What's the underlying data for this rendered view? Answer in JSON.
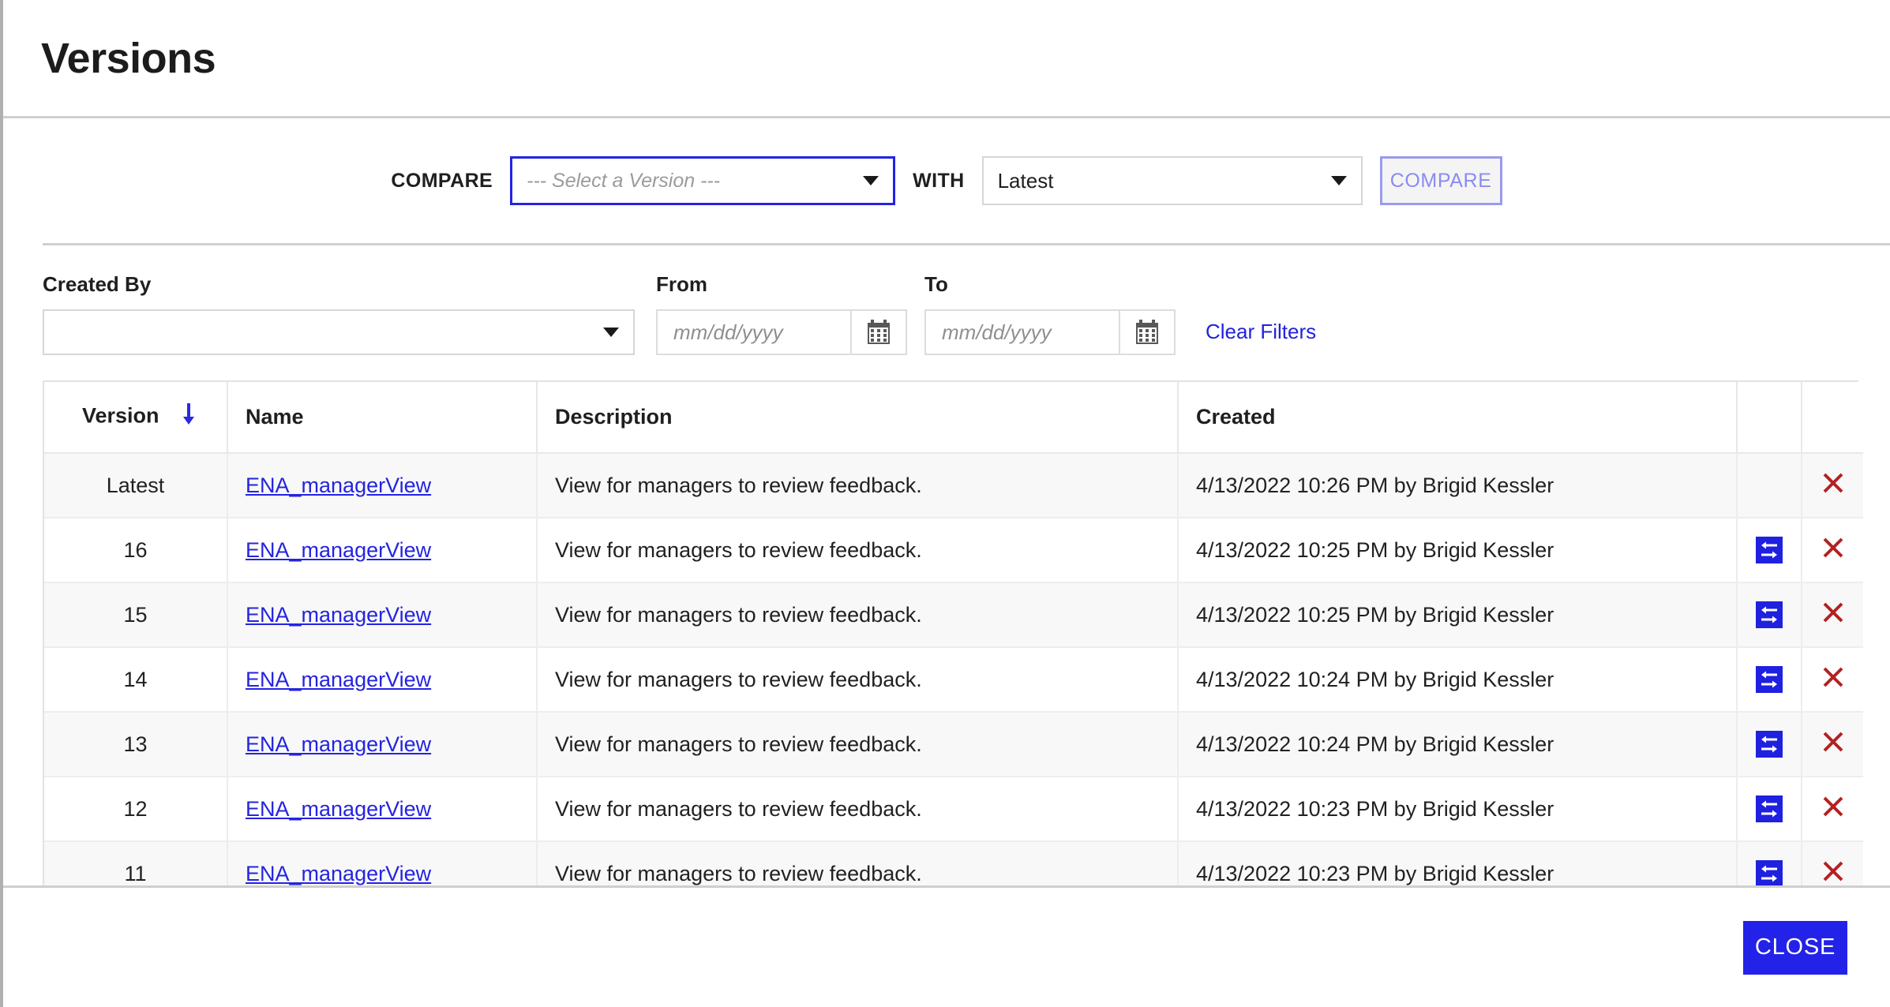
{
  "dialog": {
    "title": "Versions"
  },
  "compare_section": {
    "compare_label": "COMPARE",
    "with_label": "WITH",
    "version_select": {
      "value": "",
      "placeholder": "--- Select a Version ---",
      "focused": true
    },
    "with_select": {
      "value": "Latest"
    },
    "compare_button": {
      "label": "COMPARE",
      "disabled": true
    }
  },
  "filters": {
    "created_by_label": "Created By",
    "created_by_value": "",
    "from_label": "From",
    "from_placeholder": "mm/dd/yyyy",
    "from_value": "",
    "to_label": "To",
    "to_placeholder": "mm/dd/yyyy",
    "to_value": "",
    "clear_filters_label": "Clear Filters"
  },
  "table": {
    "columns": [
      {
        "key": "version",
        "label": "Version",
        "sorted": true,
        "sort_direction": "desc"
      },
      {
        "key": "name",
        "label": "Name"
      },
      {
        "key": "description",
        "label": "Description"
      },
      {
        "key": "created",
        "label": "Created"
      },
      {
        "key": "restore",
        "label": ""
      },
      {
        "key": "delete",
        "label": ""
      }
    ],
    "rows": [
      {
        "version": "Latest",
        "name": "ENA_managerView",
        "description": "View for managers to review feedback.",
        "created": "4/13/2022 10:26 PM by Brigid Kessler",
        "has_restore": false,
        "has_delete": true
      },
      {
        "version": "16",
        "name": "ENA_managerView",
        "description": "View for managers to review feedback.",
        "created": "4/13/2022 10:25 PM by Brigid Kessler",
        "has_restore": true,
        "has_delete": true
      },
      {
        "version": "15",
        "name": "ENA_managerView",
        "description": "View for managers to review feedback.",
        "created": "4/13/2022 10:25 PM by Brigid Kessler",
        "has_restore": true,
        "has_delete": true
      },
      {
        "version": "14",
        "name": "ENA_managerView",
        "description": "View for managers to review feedback.",
        "created": "4/13/2022 10:24 PM by Brigid Kessler",
        "has_restore": true,
        "has_delete": true
      },
      {
        "version": "13",
        "name": "ENA_managerView",
        "description": "View for managers to review feedback.",
        "created": "4/13/2022 10:24 PM by Brigid Kessler",
        "has_restore": true,
        "has_delete": true
      },
      {
        "version": "12",
        "name": "ENA_managerView",
        "description": "View for managers to review feedback.",
        "created": "4/13/2022 10:23 PM by Brigid Kessler",
        "has_restore": true,
        "has_delete": true
      },
      {
        "version": "11",
        "name": "ENA_managerView",
        "description": "View for managers to review feedback.",
        "created": "4/13/2022 10:23 PM by Brigid Kessler",
        "has_restore": true,
        "has_delete": true
      }
    ]
  },
  "footer": {
    "close_label": "CLOSE"
  },
  "icons": {
    "sort_desc": "arrow-down-icon",
    "calendar": "calendar-icon",
    "restore": "restore-swap-icon",
    "delete": "close-x-icon",
    "dropdown": "chevron-down-icon"
  },
  "colors": {
    "accent": "#2222e8",
    "link": "#2424e0",
    "delete": "#b42121",
    "disabled_text": "#8b8bf0",
    "row_stripe": "#f8f8f8"
  }
}
